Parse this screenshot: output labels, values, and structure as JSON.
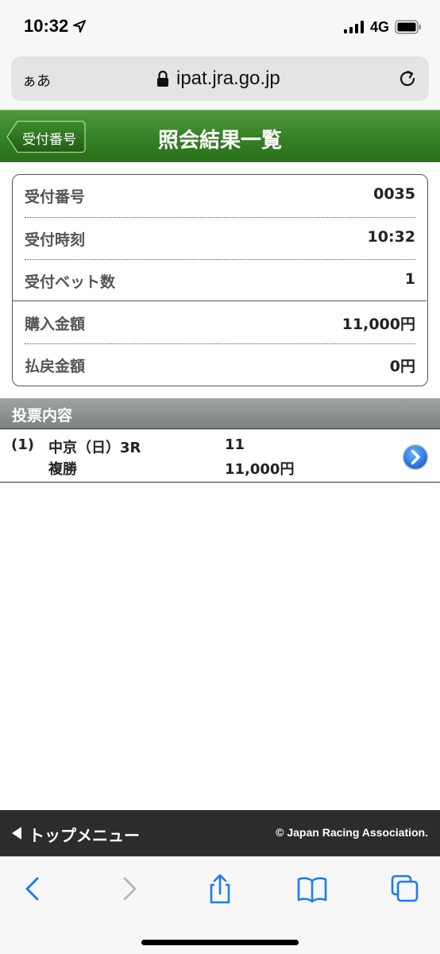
{
  "status_bar": {
    "time": "10:32",
    "network": "4G"
  },
  "browser": {
    "text_size_label": "ぁあ",
    "url": "ipat.jra.go.jp"
  },
  "header": {
    "back_label": "受付番号",
    "title": "照会結果一覧"
  },
  "summary": {
    "rows": [
      {
        "label": "受付番号",
        "value": "0035"
      },
      {
        "label": "受付時刻",
        "value": "10:32"
      },
      {
        "label": "受付ベット数",
        "value": "1"
      },
      {
        "label": "購入金額",
        "value": "11,000円"
      },
      {
        "label": "払戻金額",
        "value": "0円"
      }
    ]
  },
  "bets": {
    "section_title": "投票内容",
    "items": [
      {
        "index": "(1)",
        "race": "中京（日）3R",
        "bet_type": "複勝",
        "selection": "11",
        "amount": "11,000円"
      }
    ]
  },
  "footer": {
    "top_menu_label": "トップメニュー",
    "copyright": "© Japan Racing Association."
  },
  "toolbar": {
    "icons": [
      "back-icon",
      "forward-icon",
      "share-icon",
      "bookmarks-icon",
      "tabs-icon"
    ]
  },
  "colors": {
    "header_green": "#3a8429",
    "link_blue": "#1a7cf5",
    "bottom_bar": "#2c2c2c"
  }
}
